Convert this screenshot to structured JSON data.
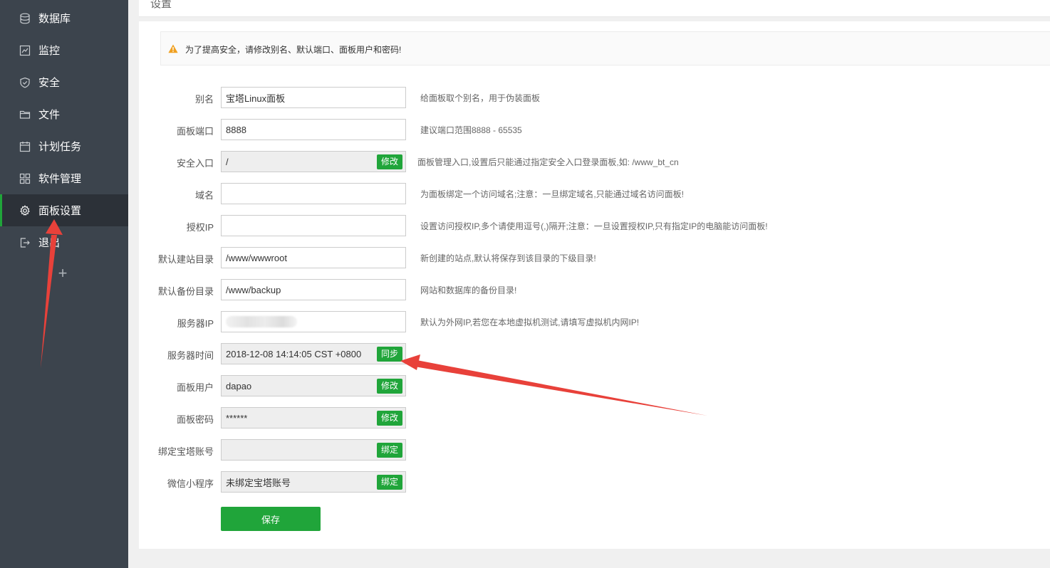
{
  "sidebar": {
    "items": [
      {
        "label": "数据库",
        "icon": "database-icon"
      },
      {
        "label": "监控",
        "icon": "monitor-icon"
      },
      {
        "label": "安全",
        "icon": "shield-icon"
      },
      {
        "label": "文件",
        "icon": "folder-icon"
      },
      {
        "label": "计划任务",
        "icon": "calendar-icon"
      },
      {
        "label": "软件管理",
        "icon": "grid-icon"
      },
      {
        "label": "面板设置",
        "icon": "gear-icon",
        "active": true
      },
      {
        "label": "退出",
        "icon": "logout-icon"
      }
    ],
    "add_label": "+"
  },
  "page": {
    "title": "设置"
  },
  "notice": {
    "text": "为了提高安全，请修改别名、默认端口、面板用户和密码!",
    "icon": "warning-icon"
  },
  "form": {
    "rows": [
      {
        "label": "别名",
        "value": "宝塔Linux面板",
        "hint": "给面板取个别名，用于伪装面板"
      },
      {
        "label": "面板端口",
        "value": "8888",
        "hint": "建议端口范围8888 - 65535"
      },
      {
        "label": "安全入口",
        "value": "/",
        "button": "修改",
        "hint": "面板管理入口,设置后只能通过指定安全入口登录面板,如: /www_bt_cn"
      },
      {
        "label": "域名",
        "value": "",
        "hint": "为面板绑定一个访问域名;注意：一旦绑定域名,只能通过域名访问面板!"
      },
      {
        "label": "授权IP",
        "value": "",
        "hint": "设置访问授权IP,多个请使用逗号(,)隔开;注意：一旦设置授权IP,只有指定IP的电脑能访问面板!"
      },
      {
        "label": "默认建站目录",
        "value": "/www/wwwroot",
        "hint": "新创建的站点,默认将保存到该目录的下级目录!"
      },
      {
        "label": "默认备份目录",
        "value": "/www/backup",
        "hint": "网站和数据库的备份目录!"
      },
      {
        "label": "服务器IP",
        "value": "",
        "hint": "默认为外网IP,若您在本地虚拟机测试,请填写虚拟机内网IP!"
      },
      {
        "label": "服务器时间",
        "value": "2018-12-08 14:14:05 CST +0800",
        "button": "同步"
      },
      {
        "label": "面板用户",
        "value": "dapao",
        "button": "修改"
      },
      {
        "label": "面板密码",
        "value": "******",
        "button": "修改"
      },
      {
        "label": "绑定宝塔账号",
        "value": "",
        "button": "绑定"
      },
      {
        "label": "微信小程序",
        "value": "未绑定宝塔账号",
        "button": "绑定"
      }
    ],
    "save_label": "保存"
  },
  "colors": {
    "sidebar_bg": "#3c444d",
    "sidebar_active_bg": "#2c3138",
    "accent_green": "#20a53a",
    "annotation_red": "#e8413a",
    "warning_orange": "#f0a020"
  }
}
